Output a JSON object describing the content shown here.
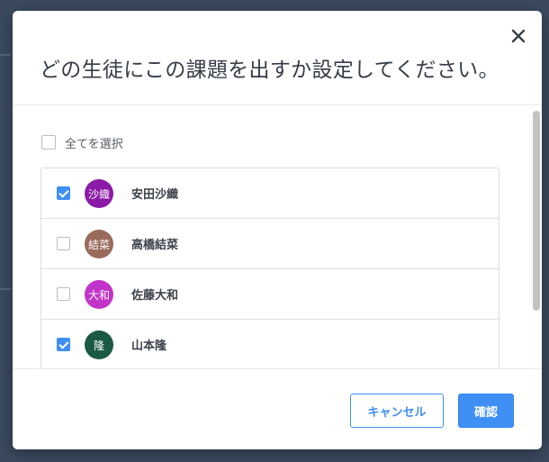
{
  "modal": {
    "title": "どの生徒にこの課題を出すか設定してください。",
    "close_icon": "close-icon"
  },
  "select_all": {
    "label": "全てを選択",
    "checked": false
  },
  "students": [
    {
      "name": "安田沙織",
      "avatar_text": "沙織",
      "avatar_color": "#8b1aa6",
      "checked": true
    },
    {
      "name": "高橋結菜",
      "avatar_text": "結菜",
      "avatar_color": "#9a6a5a",
      "checked": false
    },
    {
      "name": "佐藤大和",
      "avatar_text": "大和",
      "avatar_color": "#c233c9",
      "checked": false
    },
    {
      "name": "山本隆",
      "avatar_text": "隆",
      "avatar_color": "#1a5a44",
      "checked": true
    }
  ],
  "footer": {
    "cancel_label": "キャンセル",
    "confirm_label": "確認"
  },
  "colors": {
    "accent": "#3e8ef4",
    "backdrop": "#3b4a5f"
  }
}
